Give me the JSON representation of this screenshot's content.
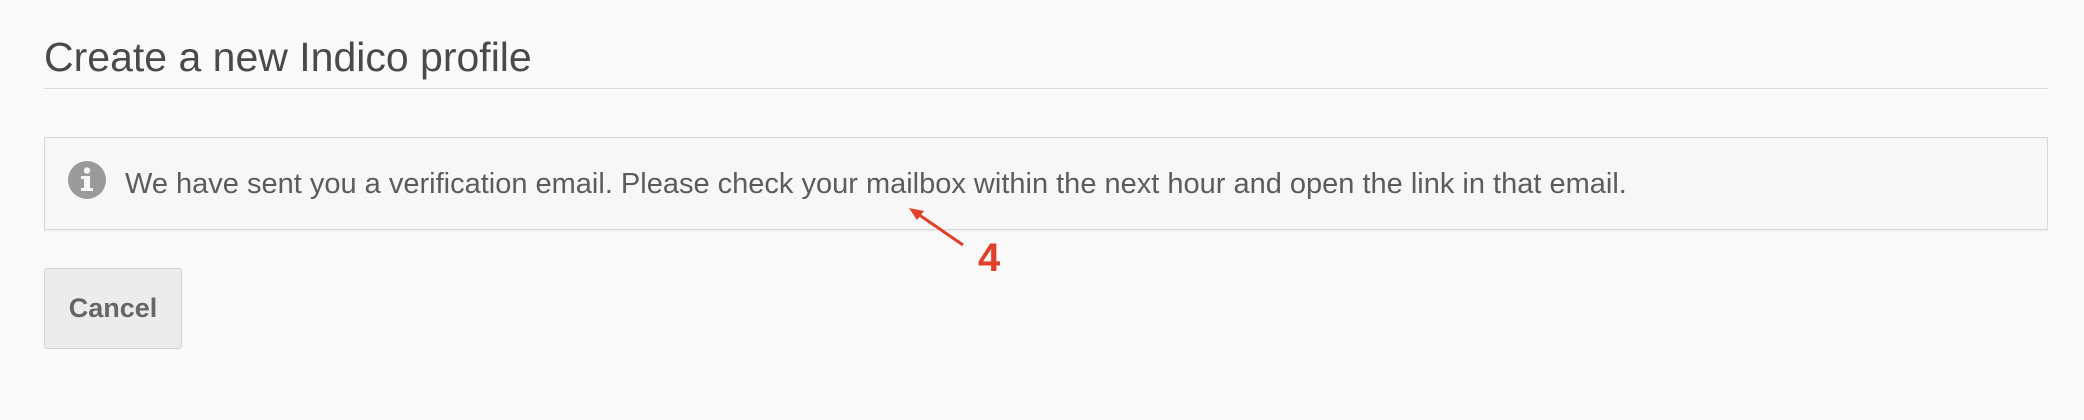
{
  "header": {
    "title": "Create a new Indico profile"
  },
  "notice": {
    "icon": "info-circle-icon",
    "message": "We have sent you a verification email. Please check your mailbox within the next hour and open the link in that email."
  },
  "actions": {
    "cancel_label": "Cancel"
  },
  "annotation": {
    "label": "4",
    "color": "#e0402a"
  }
}
